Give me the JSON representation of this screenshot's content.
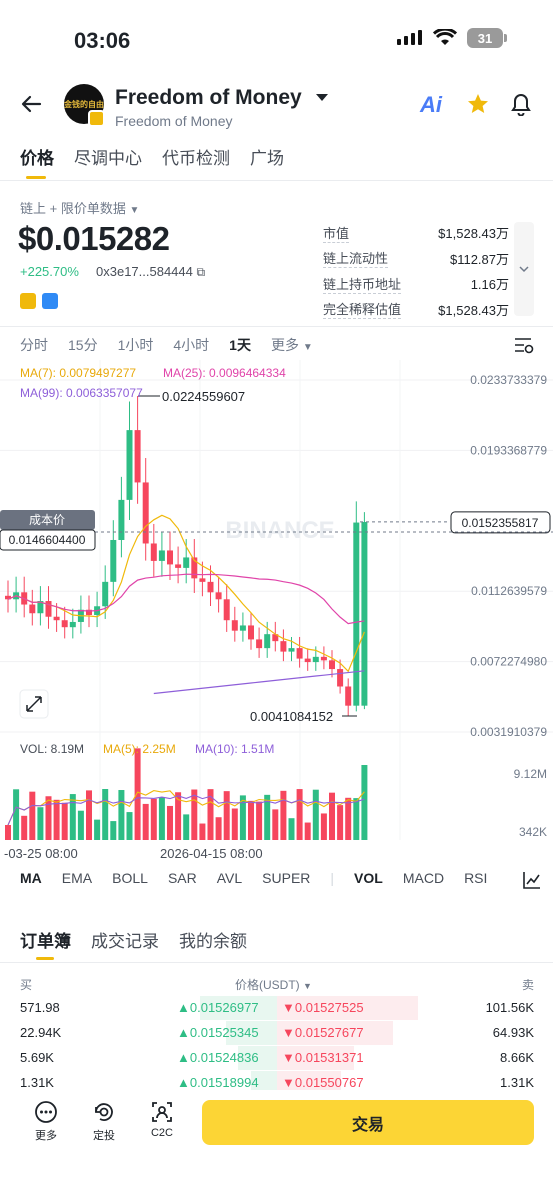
{
  "status": {
    "time": "03:06",
    "battery": "31"
  },
  "header": {
    "avatar_text": "金钱的自由",
    "token_name": "Freedom of Money",
    "token_sub": "Freedom of Money",
    "ai_label": "Ai"
  },
  "tabs": [
    "价格",
    "尽调中心",
    "代币检测",
    "广场"
  ],
  "price_panel": {
    "data_source": "链上 + 限价单数据",
    "price": "$0.015282",
    "change": "+225.70%",
    "address": "0x3e17...584444"
  },
  "stats": [
    {
      "key": "市值",
      "value": "$1,528.43万"
    },
    {
      "key": "链上流动性",
      "value": "$112.87万"
    },
    {
      "key": "链上持币地址",
      "value": "1.16万"
    },
    {
      "key": "完全稀释估值",
      "value": "$1,528.43万"
    }
  ],
  "intervals": [
    "分时",
    "15分",
    "1小时",
    "4小时",
    "1天",
    "更多"
  ],
  "active_interval": "1天",
  "chart_data": {
    "type": "candlestick",
    "ma_legend": {
      "ma7": "MA(7): 0.0079497277",
      "ma25": "MA(25): 0.0096464334",
      "ma99": "MA(99): 0.0063357077"
    },
    "y_ticks": [
      "0.0233733379",
      "0.0193368779",
      "0.0152355817",
      "0.0112639579",
      "0.0072274980",
      "0.0031910379"
    ],
    "high_label": "0.0224559607",
    "low_label": "0.0041084152",
    "cost_label": "成本价",
    "cost_value": "0.0146604400",
    "watermark": "BINANCE",
    "x_labels": [
      "-03-25 08:00",
      "2026-04-15 08:00"
    ],
    "colors": {
      "up": "#2ebd85",
      "down": "#f6465d",
      "ma7": "#f0b90b",
      "ma25": "#e044a9",
      "ma99": "#8e5fd9"
    },
    "volume_legend": {
      "vol": "VOL: 8.19M",
      "ma5": "MA(5): 2.25M",
      "ma10": "MA(10): 1.51M"
    },
    "volume_ticks": [
      "9.12M",
      "342K"
    ]
  },
  "indicators": [
    "MA",
    "EMA",
    "BOLL",
    "SAR",
    "AVL",
    "SUPER",
    "VOL",
    "MACD",
    "RSI"
  ],
  "orderbook": {
    "tabs": [
      "订单簿",
      "成交记录",
      "我的余额"
    ],
    "head": {
      "buy": "买",
      "price": "价格(USDT)",
      "sell": "卖"
    },
    "rows": [
      {
        "bid_qty": "571.98",
        "bid": "0.01526977",
        "ask": "0.01527525",
        "ask_qty": "101.56K",
        "bid_depth": 0.3,
        "ask_depth": 0.55
      },
      {
        "bid_qty": "22.94K",
        "bid": "0.01525345",
        "ask": "0.01527677",
        "ask_qty": "64.93K",
        "bid_depth": 0.2,
        "ask_depth": 0.45
      },
      {
        "bid_qty": "5.69K",
        "bid": "0.01524836",
        "ask": "0.01531371",
        "ask_qty": "8.66K",
        "bid_depth": 0.15,
        "ask_depth": 0.3
      },
      {
        "bid_qty": "1.31K",
        "bid": "0.01518994",
        "ask": "0.01550767",
        "ask_qty": "1.31K",
        "bid_depth": 0.1,
        "ask_depth": 0.25
      }
    ]
  },
  "bottom": {
    "more": "更多",
    "dca": "定投",
    "c2c": "C2C",
    "trade": "交易"
  }
}
